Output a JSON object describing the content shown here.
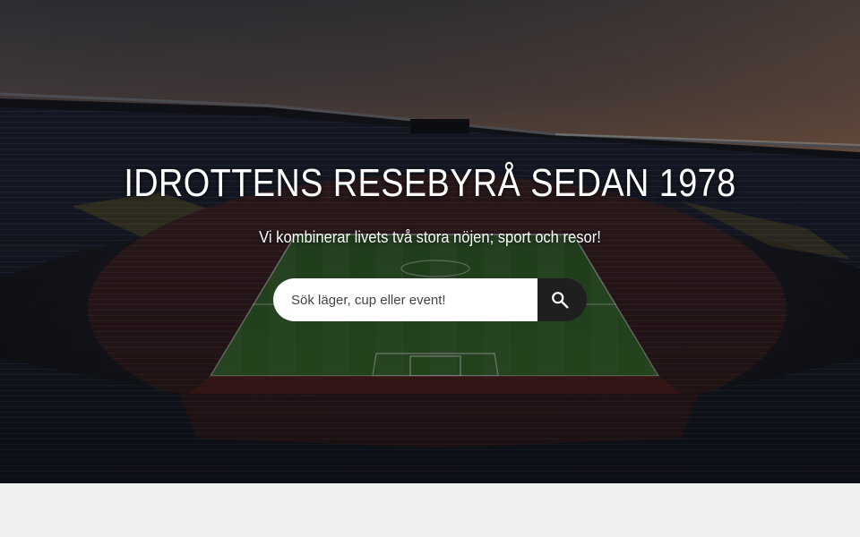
{
  "hero": {
    "title": "IDROTTENS RESEBYRÅ SEDAN 1978",
    "subtitle": "Vi kombinerar livets två stora nöjen; sport och resor!",
    "background_image": "stadium-night-photo"
  },
  "search": {
    "placeholder": "Sök läger, cup eller event!",
    "value": "",
    "button_icon": "search-icon"
  },
  "colors": {
    "search_button": "#1f1f1f",
    "text": "#ffffff",
    "page_background": "#f0f0f0",
    "pitch": "#3f7a34"
  }
}
